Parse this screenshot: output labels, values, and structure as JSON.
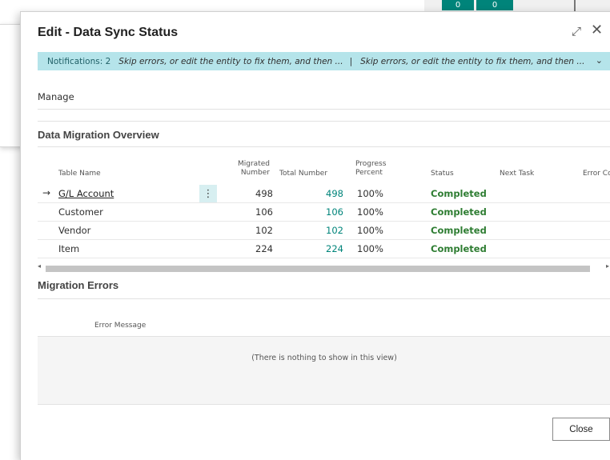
{
  "background": {
    "tiles": [
      "0",
      "0"
    ]
  },
  "dialog": {
    "title": "Edit - Data Sync Status",
    "notification": {
      "count_label": "Notifications: 2",
      "message_1": "Skip errors, or edit the entity to fix them, and then ...",
      "separator": "|",
      "message_2": "Skip errors, or edit the entity to fix them, and then ..."
    },
    "manage_label": "Manage",
    "overview": {
      "title": "Data Migration Overview",
      "columns": {
        "table_name": "Table Name",
        "migrated_number_1": "Migrated",
        "migrated_number_2": "Number",
        "total_number": "Total Number",
        "progress_1": "Progress",
        "progress_2": "Percent",
        "status": "Status",
        "next_task": "Next Task",
        "error_count": "Error Co"
      },
      "rows": [
        {
          "table_name": "G/L Account",
          "migrated": "498",
          "total": "498",
          "percent": "100%",
          "status": "Completed"
        },
        {
          "table_name": "Customer",
          "migrated": "106",
          "total": "106",
          "percent": "100%",
          "status": "Completed"
        },
        {
          "table_name": "Vendor",
          "migrated": "102",
          "total": "102",
          "percent": "100%",
          "status": "Completed"
        },
        {
          "table_name": "Item",
          "migrated": "224",
          "total": "224",
          "percent": "100%",
          "status": "Completed"
        }
      ]
    },
    "errors": {
      "title": "Migration Errors",
      "column": "Error Message",
      "empty_text": "(There is nothing to show in this view)"
    },
    "close_label": "Close"
  },
  "colors": {
    "notification_bg": "#b5e4ea",
    "accent_teal": "#00847a",
    "status_green": "#2e7d32"
  }
}
